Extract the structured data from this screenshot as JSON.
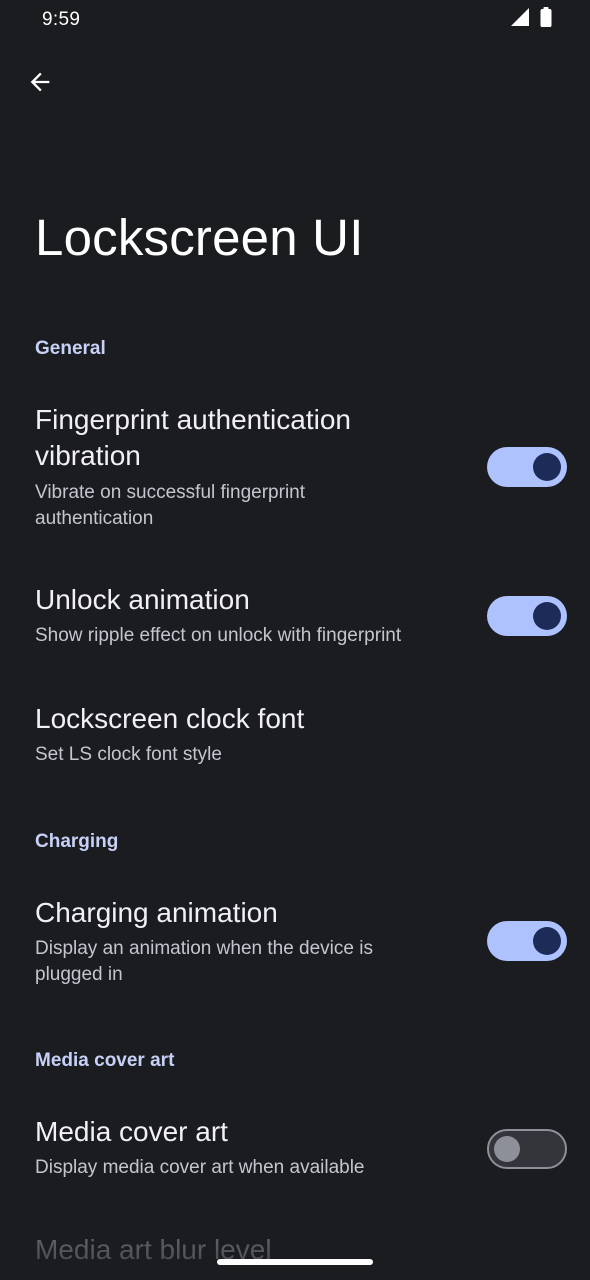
{
  "status_bar": {
    "time": "9:59",
    "icons": [
      "signal-icon",
      "battery-icon"
    ]
  },
  "header": {
    "back_icon": "arrow-back-icon",
    "title": "Lockscreen UI"
  },
  "sections": {
    "general": {
      "header": "General",
      "items": [
        {
          "title_line1": "Fingerprint authentication",
          "title_line2": "vibration",
          "summary_line1": "Vibrate on successful fingerprint",
          "summary_line2": "authentication",
          "toggle": "on"
        },
        {
          "title": "Unlock animation",
          "summary": "Show ripple effect on unlock with fingerprint",
          "toggle": "on"
        },
        {
          "title": "Lockscreen clock font",
          "summary": "Set LS clock font style"
        }
      ]
    },
    "charging": {
      "header": "Charging",
      "items": [
        {
          "title": "Charging animation",
          "summary_line1": "Display an animation when the device is",
          "summary_line2": "plugged in",
          "toggle": "on"
        }
      ]
    },
    "media": {
      "header": "Media cover art",
      "items": [
        {
          "title": "Media cover art",
          "summary": "Display media cover art when available",
          "toggle": "off"
        },
        {
          "title": "Media art blur level"
        }
      ]
    }
  },
  "colors": {
    "background": "#1b1c20",
    "accent": "#adc2ff",
    "accent_thumb": "#1d2b59",
    "section_header": "#c7d0f7",
    "text_primary": "#f1f0f4",
    "text_secondary": "#c4c6cf"
  }
}
